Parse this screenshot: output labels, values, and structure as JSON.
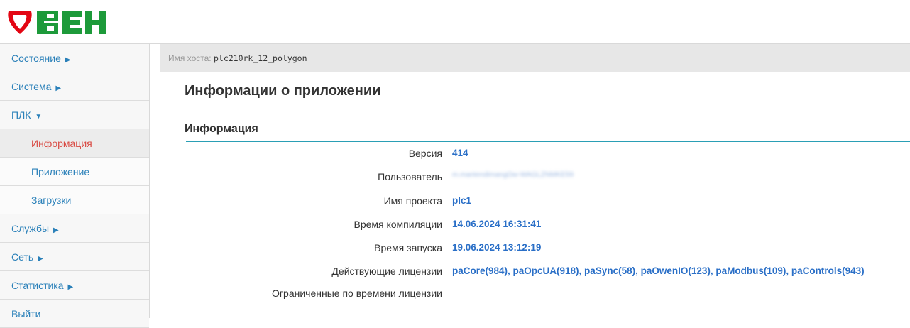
{
  "header": {
    "logo_text": "ОВЕН"
  },
  "sidebar": {
    "items": [
      {
        "label": "Состояние",
        "caret": "▶"
      },
      {
        "label": "Система",
        "caret": "▶"
      },
      {
        "label": "ПЛК",
        "caret": "▼"
      },
      {
        "label": "Информация",
        "active": true
      },
      {
        "label": "Приложение"
      },
      {
        "label": "Загрузки"
      },
      {
        "label": "Службы",
        "caret": "▶"
      },
      {
        "label": "Сеть",
        "caret": "▶"
      },
      {
        "label": "Статистика",
        "caret": "▶"
      },
      {
        "label": "Выйти"
      }
    ]
  },
  "hostbar": {
    "label": "Имя хоста:",
    "host": "plc210rk_12_polygon"
  },
  "main": {
    "page_title": "Информации о приложении",
    "section_title": "Информация",
    "rows": [
      {
        "label": "Версия",
        "value": "414"
      },
      {
        "label": "Пользователь",
        "value": "m.mantendimangOw-WAGLZNMKE59",
        "blurred": true
      },
      {
        "label": "Имя проекта",
        "value": "plc1"
      },
      {
        "label": "Время компиляции",
        "value": "14.06.2024 16:31:41"
      },
      {
        "label": "Время запуска",
        "value": "19.06.2024 13:12:19"
      },
      {
        "label": "Действующие лицензии",
        "value": "paCore(984), paOpcUA(918), paSync(58), paOwenIO(123), paModbus(109), paControls(943)"
      },
      {
        "label": "Ограниченные по времени лицензии",
        "value": ""
      }
    ]
  },
  "colors": {
    "brand_red": "#e30613",
    "link_blue": "#2a80b9",
    "value_blue": "#2a6fc7",
    "active_red": "#d94a43",
    "accent_line": "#2a9fb5"
  }
}
